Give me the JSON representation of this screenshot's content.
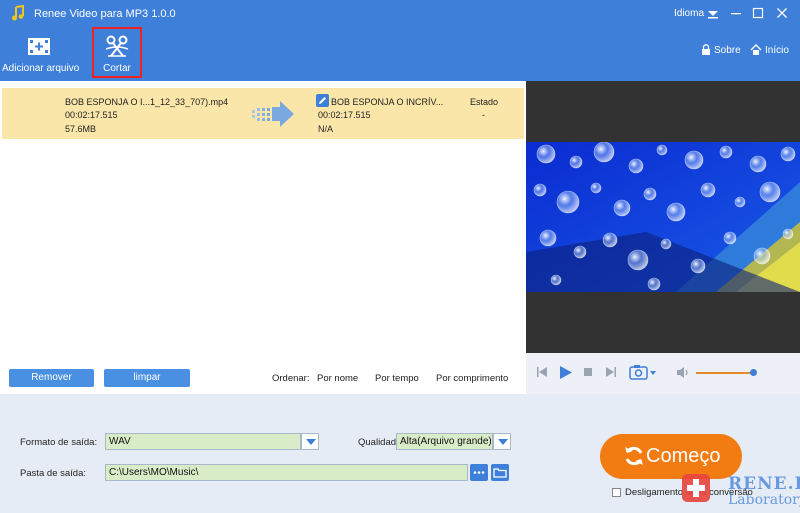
{
  "titlebar": {
    "title": "Renee Video para MP3 1.0.0",
    "language_label": "Idioma",
    "icons": [
      "music-note-icon",
      "chevron-down-icon",
      "minimize-icon",
      "maximize-icon",
      "close-icon"
    ]
  },
  "toolbar": {
    "add_file": "Adicionar arquivo",
    "cut": "Cortar",
    "about": "Sobre",
    "home": "Início"
  },
  "file_row": {
    "source_name": "BOB ESPONJA O I...1_12_33_707).mp4",
    "source_duration": "00:02:17.515",
    "source_size": "57.6MB",
    "output_name": "BOB ESPONJA O INCRÍV...",
    "output_duration": "00:02:17.515",
    "output_size": "N/A",
    "status_header": "Estado",
    "status_value": "-"
  },
  "list_actions": {
    "remove": "Remover",
    "clear": "limpar",
    "sort_label": "Ordenar:",
    "sort_by_name": "Por nome",
    "sort_by_time": "Por tempo",
    "sort_by_length": "Por comprimento"
  },
  "player": {
    "volume_level": 0.9
  },
  "settings": {
    "output_format_label": "Formato de saída:",
    "output_format_value": "WAV",
    "quality_label": "Qualidade:",
    "quality_value": "Alta(Arquivo grande)",
    "output_folder_label": "Pasta de saída:",
    "output_folder_value": "C:\\Users\\MO\\Music\\",
    "start_button": "Começo",
    "shutdown_label": "Desligamento após conversão"
  },
  "watermark": {
    "line1": "RENE.E",
    "line2": "Laboratory"
  },
  "colors": {
    "accent": "#3d7fd9",
    "selected_row": "#fbe6a9",
    "start_button": "#f27c12",
    "field_bg": "#d9ecc8"
  }
}
